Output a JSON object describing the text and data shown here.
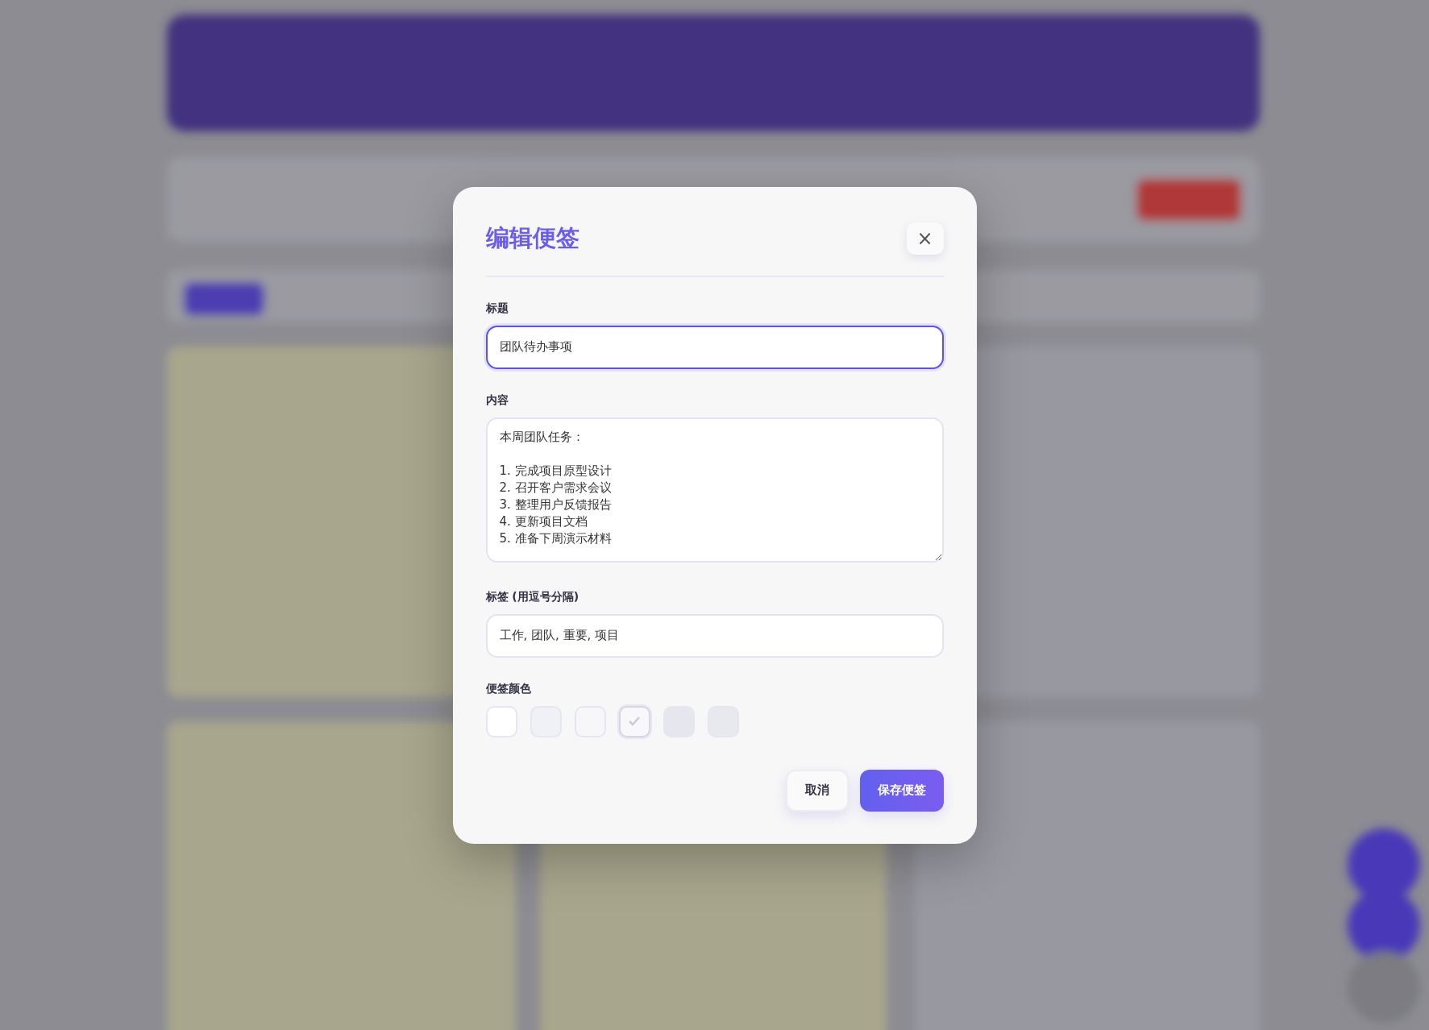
{
  "dialog": {
    "title": "编辑便签",
    "close_label": "×"
  },
  "fields": [
    {
      "kind": "input",
      "label": "标题",
      "value": "团队待办事项",
      "focused": true
    },
    {
      "kind": "textarea",
      "label": "内容",
      "value": "本周团队任务：\n\n1. 完成项目原型设计\n2. 召开客户需求会议\n3. 整理用户反馈报告\n4. 更新项目文档\n5. 准备下周演示材料",
      "focused": false
    },
    {
      "kind": "input",
      "label": "标签 (用逗号分隔)",
      "value": "工作, 团队, 重要, 项目",
      "focused": false
    }
  ],
  "color_picker": {
    "label": "便签颜色",
    "colors": [
      {
        "color": "#ffffff",
        "selected": false
      },
      {
        "color": "#eff1f6",
        "selected": false
      },
      {
        "color": "#f7f7f9",
        "selected": false
      },
      {
        "color": "#f8f8fa",
        "selected": true
      },
      {
        "color": "#e6e6ee",
        "selected": false
      },
      {
        "color": "#e8e8ef",
        "selected": false
      }
    ]
  },
  "buttons": [
    {
      "label": "取消",
      "kind": "secondary"
    },
    {
      "label": "保存便签",
      "kind": "primary"
    }
  ]
}
